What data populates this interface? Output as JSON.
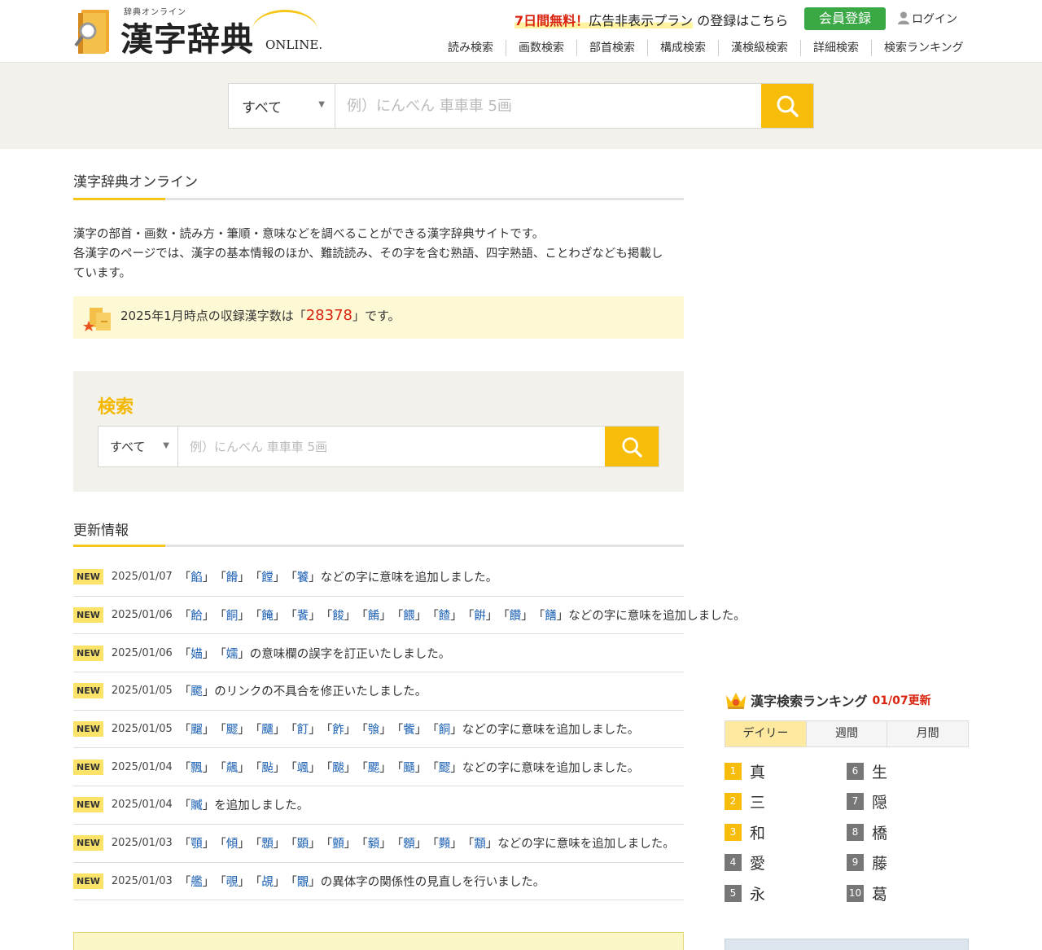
{
  "header": {
    "logo_small": "辞典オンライン",
    "logo_main": "漢字辞典",
    "logo_online": "ONLINE.",
    "promo": {
      "emph": "7日間無料！",
      "highlight": "広告非表示プラン",
      "rest": "の登録はこちら"
    },
    "register_label": "会員登録",
    "login_label": "ログイン",
    "nav": [
      "読み検索",
      "画数検索",
      "部首検索",
      "構成検索",
      "漢検級検索",
      "詳細検索",
      "検索ランキング"
    ]
  },
  "top_search": {
    "select_value": "すべて",
    "placeholder": "例）にんべん 車車車 5画"
  },
  "main": {
    "section_title": "漢字辞典オンライン",
    "intro_lines": [
      "漢字の部首・画数・読み方・筆順・意味などを調べることができる漢字辞典サイトです。",
      "各漢字のページでは、漢字の基本情報のほか、難読読み、その字を含む熟語、四字熟語、ことわざなども掲載し",
      "ています。"
    ],
    "count": {
      "prefix": "2025年1月時点の収録漢字数は「",
      "number": "28378",
      "suffix": "」です。"
    },
    "search_title": "検索",
    "search_select": "すべて",
    "search_placeholder": "例）にんべん 車車車 5画",
    "news_title": "更新情報",
    "news": [
      {
        "badge": "NEW",
        "date": "2025/01/07",
        "chars": [
          "餡",
          "餶",
          "饄",
          "饕"
        ],
        "text": "などの字に意味を追加しました。"
      },
      {
        "badge": "NEW",
        "date": "2025/01/06",
        "chars": [
          "餄",
          "餇",
          "餣",
          "餥",
          "餕",
          "餚",
          "餵",
          "餷",
          "餠",
          "饡",
          "饍"
        ],
        "text": "などの字に意味を追加しました。"
      },
      {
        "badge": "NEW",
        "date": "2025/01/06",
        "chars": [
          "媌",
          "嬬"
        ],
        "text": "の意味欄の誤字を訂正いたしました。"
      },
      {
        "badge": "NEW",
        "date": "2025/01/05",
        "chars": [
          "颸"
        ],
        "text": "のリンクの不具合を修正いたしました。"
      },
      {
        "badge": "NEW",
        "date": "2025/01/05",
        "chars": [
          "飀",
          "飂",
          "飅",
          "飣",
          "飵",
          "飸",
          "飺",
          "餇"
        ],
        "text": "などの字に意味を追加しました。"
      },
      {
        "badge": "NEW",
        "date": "2025/01/04",
        "chars": [
          "飄",
          "飆",
          "颭",
          "颯",
          "颰",
          "颸",
          "颾",
          "飂"
        ],
        "text": "などの字に意味を追加しました。"
      },
      {
        "badge": "NEW",
        "date": "2025/01/04",
        "chars": [
          "贓"
        ],
        "text": "を追加しました。"
      },
      {
        "badge": "NEW",
        "date": "2025/01/03",
        "chars": [
          "顎",
          "傾",
          "顋",
          "顕",
          "顫",
          "顡",
          "顖",
          "顭",
          "顬"
        ],
        "text": "などの字に意味を追加しました。"
      },
      {
        "badge": "NEW",
        "date": "2025/01/03",
        "chars": [
          "艦",
          "覗",
          "覘",
          "覵"
        ],
        "text": "の異体字の関係性の見直しを行いました。"
      }
    ]
  },
  "ranking": {
    "title": "漢字検索ランキング",
    "updated": "01/07更新",
    "tabs": [
      "デイリー",
      "週間",
      "月間"
    ],
    "active_tab": "デイリー",
    "items": [
      {
        "rank": "1",
        "kanji": "真"
      },
      {
        "rank": "2",
        "kanji": "三"
      },
      {
        "rank": "3",
        "kanji": "和"
      },
      {
        "rank": "4",
        "kanji": "愛"
      },
      {
        "rank": "5",
        "kanji": "永"
      },
      {
        "rank": "6",
        "kanji": "生"
      },
      {
        "rank": "7",
        "kanji": "隠"
      },
      {
        "rank": "8",
        "kanji": "橋"
      },
      {
        "rank": "9",
        "kanji": "藤"
      },
      {
        "rank": "10",
        "kanji": "葛"
      }
    ]
  },
  "colors": {
    "accent": "#f7bd0a",
    "register": "#3aa845",
    "link": "#1a5fb4",
    "alert": "#d9230f"
  }
}
